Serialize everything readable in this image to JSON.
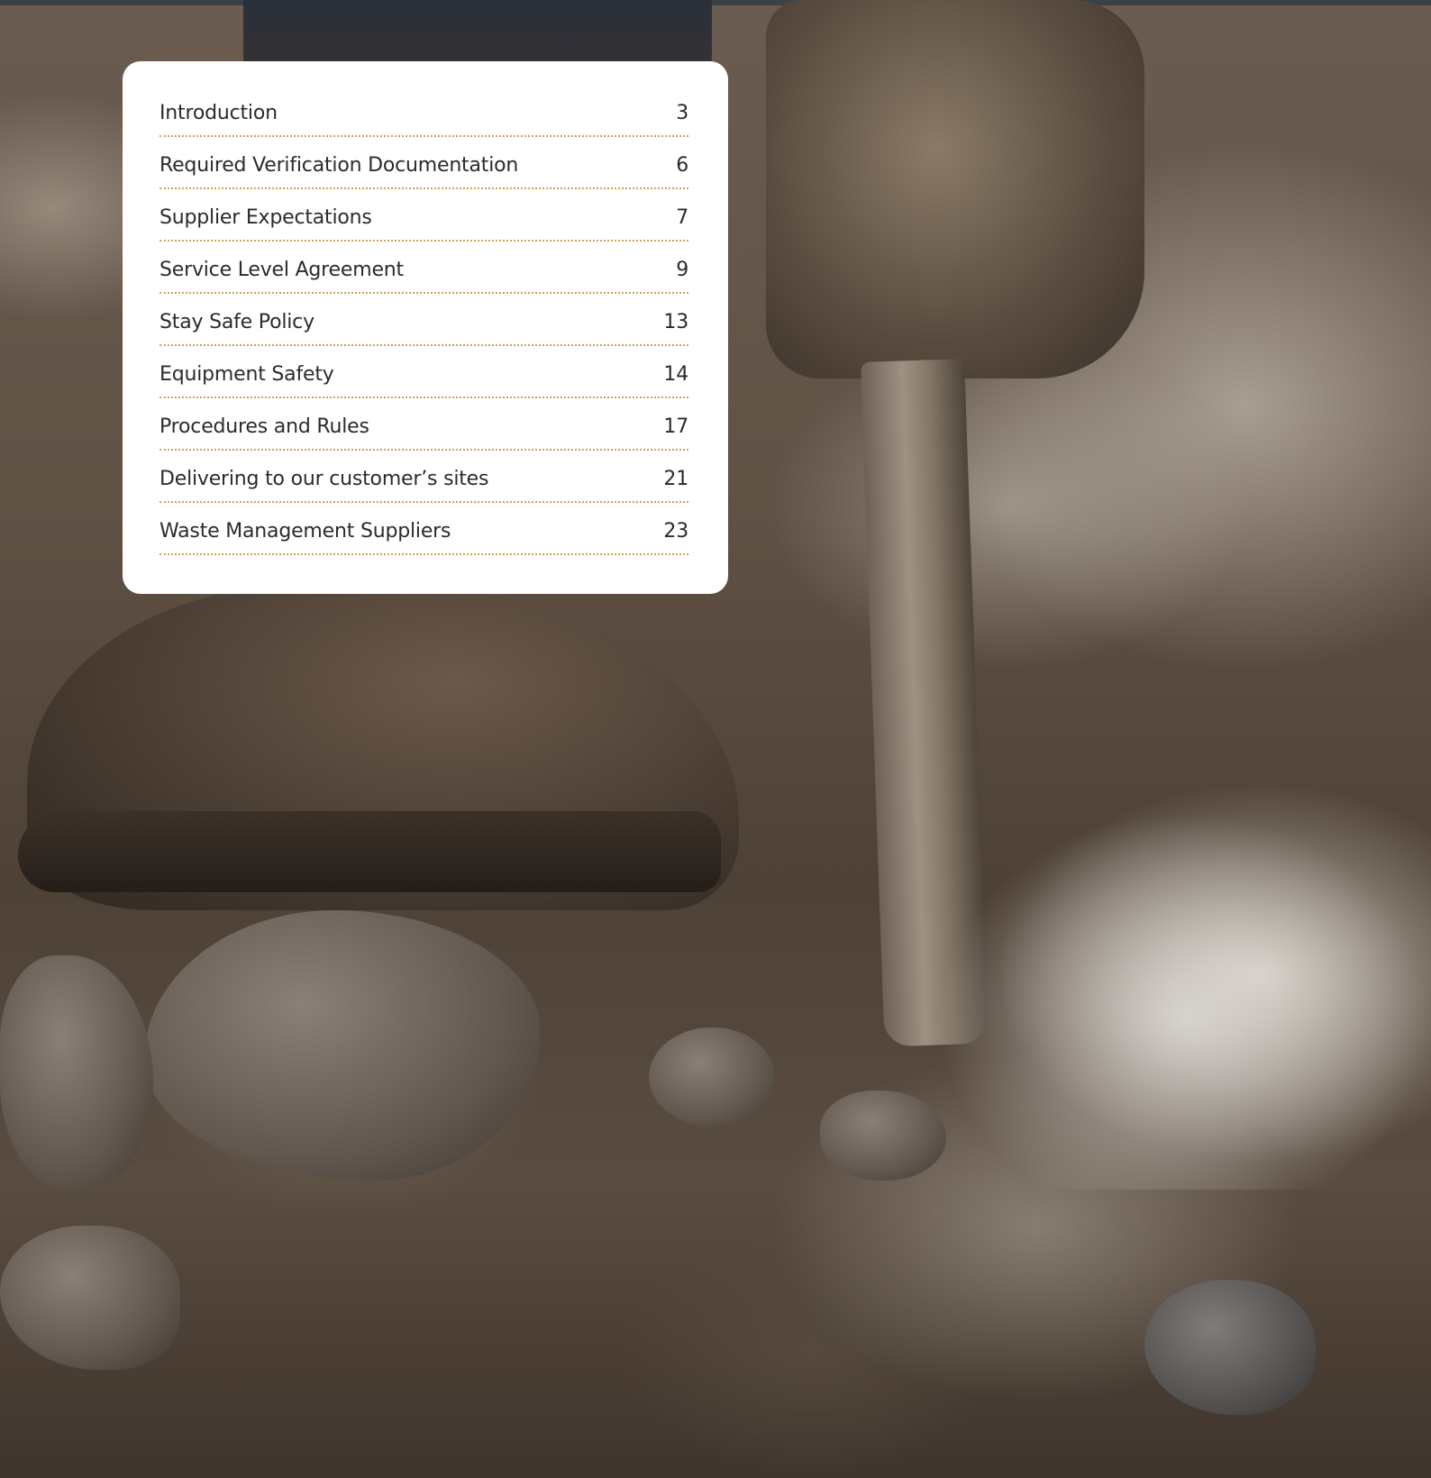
{
  "toc": {
    "entries": [
      {
        "title": "Introduction",
        "page": "3"
      },
      {
        "title": "Required Verification Documentation",
        "page": "6"
      },
      {
        "title": "Supplier Expectations",
        "page": "7"
      },
      {
        "title": "Service Level Agreement",
        "page": "9"
      },
      {
        "title": "Stay Safe Policy",
        "page": "13"
      },
      {
        "title": "Equipment Safety",
        "page": "14"
      },
      {
        "title": "Procedures and Rules",
        "page": "17"
      },
      {
        "title": "Delivering to our customer’s sites",
        "page": "21"
      },
      {
        "title": "Waste Management Suppliers",
        "page": "23"
      }
    ]
  },
  "colors": {
    "dotted_rule": "#c9a25a",
    "card_background": "#ffffff",
    "text": "#2b2b2b"
  }
}
